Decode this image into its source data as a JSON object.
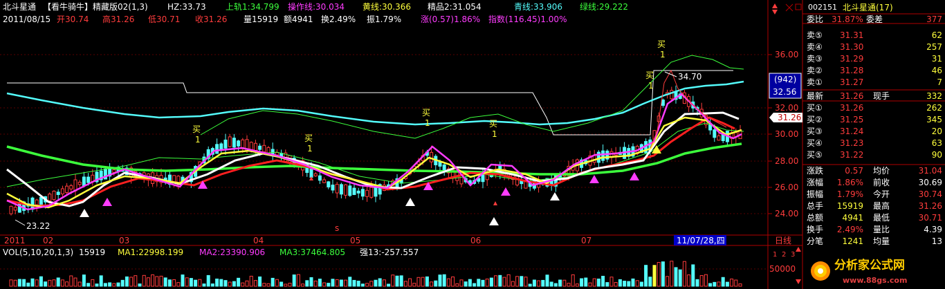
{
  "header": {
    "stock_name": "北斗星通",
    "indicator_name": "【看牛骑牛】精藏版02(1,3)",
    "hz": "HZ:33.73",
    "upper_rail": "上轨1:34.799",
    "op_line": "操作线:30.034",
    "yellow_line": "黄线:30.366",
    "boutique": "精品2:31.054",
    "cyan_line": "青线:33.906",
    "green_line": "绿线:29.222"
  },
  "info_bar": {
    "date": "2011/08/15",
    "open": "开30.74",
    "high": "高31.26",
    "low": "低30.71",
    "close": "收31.26",
    "volume": "量15919",
    "amount": "额4941",
    "turnover": "换2.49%",
    "amplitude": "振1.79%",
    "change": "涨(0.57)1.86%",
    "index": "指数(116.45)1.00%"
  },
  "price_axis": [
    "36.00",
    "32.00",
    "30.00",
    "28.00",
    "26.00",
    "24.00"
  ],
  "price_tag_942": "(942)",
  "price_tag_value": "32.56",
  "last_price_tag": "31.26",
  "x_axis": [
    "2011",
    "02",
    "03",
    "04",
    "05",
    "06",
    "07"
  ],
  "x_cursor_date": "11/07/28,四",
  "period_label": "日线",
  "annotations": {
    "buy": "买",
    "one": "1",
    "high_mark": "34.70",
    "low_mark": "23.22",
    "s_mark": "s"
  },
  "volume_bar": {
    "label": "VOL(5,10,20,1,3)",
    "value": "15919",
    "ma1": "MA1:22998.199",
    "ma2": "MA2:23390.906",
    "ma3": "MA3:37464.805",
    "strong": "强13:-257.557",
    "axis": "50000",
    "scale_1": "1",
    "scale_2": "2",
    "scale_3": "3"
  },
  "quote": {
    "code": "002151",
    "name": "北斗星通(17)",
    "weibi_label": "委比",
    "weibi_value": "31.87%",
    "weicha_label": "委差",
    "weicha_value": "377",
    "sell": [
      {
        "label": "卖⑤",
        "price": "31.31",
        "vol": "62"
      },
      {
        "label": "卖④",
        "price": "31.30",
        "vol": "257"
      },
      {
        "label": "卖③",
        "price": "31.29",
        "vol": "31"
      },
      {
        "label": "卖②",
        "price": "31.28",
        "vol": "46"
      },
      {
        "label": "卖①",
        "price": "31.27",
        "vol": "7"
      }
    ],
    "latest_label": "最新",
    "latest_value": "31.26",
    "cur_label": "现手",
    "cur_value": "332",
    "buy": [
      {
        "label": "买①",
        "price": "31.26",
        "vol": "262"
      },
      {
        "label": "买②",
        "price": "31.25",
        "vol": "345"
      },
      {
        "label": "买③",
        "price": "31.24",
        "vol": "20"
      },
      {
        "label": "买④",
        "price": "31.23",
        "vol": "63"
      },
      {
        "label": "买⑤",
        "price": "31.22",
        "vol": "90"
      }
    ],
    "stats": [
      {
        "l1": "涨跌",
        "v1": "0.57",
        "l2": "均价",
        "v2": "31.04"
      },
      {
        "l1": "涨幅",
        "v1": "1.86%",
        "l2": "前收",
        "v2": "30.69"
      },
      {
        "l1": "振幅",
        "v1": "1.79%",
        "l2": "今开",
        "v2": "30.74"
      },
      {
        "l1": "总手",
        "v1": "15919",
        "l2": "最高",
        "v2": "31.26"
      },
      {
        "l1": "总额",
        "v1": "4941",
        "l2": "最低",
        "v2": "30.71"
      },
      {
        "l1": "换手",
        "v1": "2.49%",
        "l2": "量比",
        "v2": "4.39"
      },
      {
        "l1": "分笔",
        "v1": "1241",
        "l2": "均量",
        "v2": "13"
      }
    ]
  },
  "watermark": {
    "name": "分析家公式网",
    "url": "www.88gs.com"
  },
  "colors": {
    "up": "#ff3c3c",
    "down": "#54fcfc",
    "yellow": "#ffff3c",
    "magenta": "#ff3cff",
    "green": "#3cff3c",
    "white": "#ffffff",
    "axis_red": "#b00000"
  }
}
